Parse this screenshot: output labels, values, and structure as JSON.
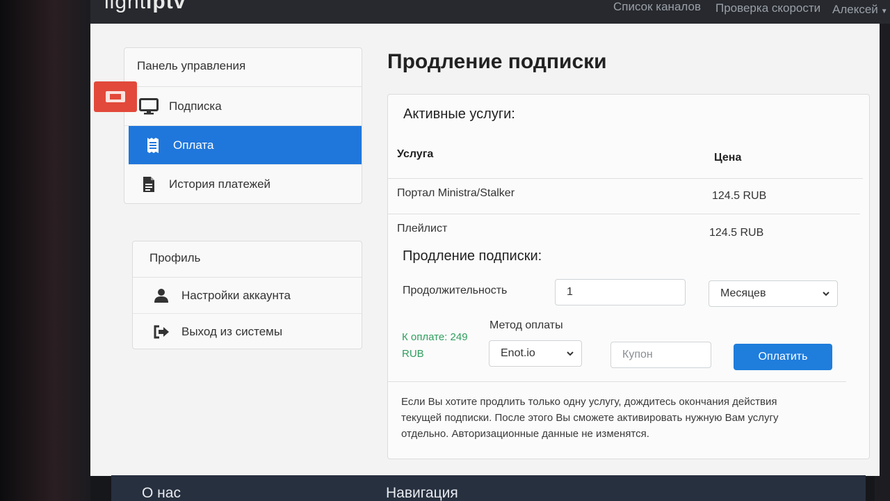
{
  "header": {
    "logo_light": "light",
    "logo_bold": "iptv",
    "nav": [
      {
        "label": "Список каналов"
      },
      {
        "label": "Проверка скорости"
      },
      {
        "label": "Алексей"
      }
    ]
  },
  "sidebar": {
    "control_panel": {
      "title": "Панель управления",
      "items": [
        {
          "label": "Подписка",
          "icon": "monitor-icon",
          "active": false
        },
        {
          "label": "Оплата",
          "icon": "receipt-icon",
          "active": true
        },
        {
          "label": "История платежей",
          "icon": "document-icon",
          "active": false
        }
      ]
    },
    "profile": {
      "title": "Профиль",
      "items": [
        {
          "label": "Настройки аккаунта",
          "icon": "user-icon"
        },
        {
          "label": "Выход из системы",
          "icon": "sign-out-icon"
        }
      ]
    }
  },
  "main": {
    "title": "Продление подписки",
    "active_services": {
      "title": "Активные услуги:",
      "columns": [
        "Услуга",
        "Цена"
      ],
      "rows": [
        {
          "service": "Портал Ministra/Stalker",
          "price": "124.5 RUB"
        },
        {
          "service": "Плейлист",
          "price": "124.5 RUB"
        }
      ]
    },
    "renewal": {
      "title": "Продление подписки:",
      "duration_label": "Продолжительность",
      "duration_value": "1",
      "period_value": "Месяцев",
      "total_label": "К оплате: 249 RUB",
      "method_label": "Метод оплаты",
      "method_value": "Enot.io",
      "coupon_placeholder": "Купон",
      "pay_button": "Оплатить"
    },
    "note": "Если Вы хотите продлить только одну услугу, дождитесь окончания действия текущей подписки. После этого Вы сможете активировать нужную Вам услугу отдельно. Авторизационные данные не изменятся."
  },
  "footer": {
    "about": "О нас",
    "navigation": "Навигация"
  },
  "colors": {
    "accent": "#1f77dc",
    "total_green": "#2f9e5e",
    "tab_red": "#e2493a"
  }
}
